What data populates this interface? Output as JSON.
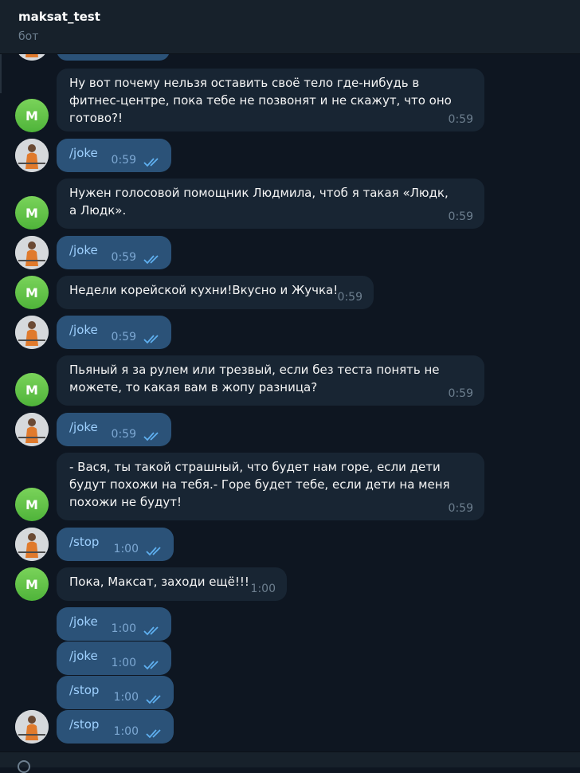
{
  "header": {
    "title": "maksat_test",
    "status": "бот"
  },
  "bot_avatar_letter": "M",
  "messages": [
    {
      "text": "Ну вот почему нельзя оставить своё тело где-нибудь в фитнес-центре, пока тебе не позвонят и не скажут, что оно готово?!",
      "time": "0:59"
    },
    {
      "text": "/joke",
      "time": "0:59"
    },
    {
      "text": "Нужен голосовой помощник Людмила, чтоб я такая «Людк, а Людк».",
      "time": "0:59"
    },
    {
      "text": "/joke",
      "time": "0:59"
    },
    {
      "text": "Недели корейской кухни!Вкусно и Жучка!",
      "time": "0:59"
    },
    {
      "text": "/joke",
      "time": "0:59"
    },
    {
      "text": "Пьяный я за рулем или трезвый, если без теста понять не можете, то какая вам в жопу разница?",
      "time": "0:59"
    },
    {
      "text": "/joke",
      "time": "0:59"
    },
    {
      "text": "- Вася, ты такой страшный, что будет нам горе, если дети будут похожи на тебя.- Горе будет тебе, если дети на меня похожи не будут!",
      "time": "0:59"
    },
    {
      "text": "/stop",
      "time": "1:00"
    },
    {
      "text": "Пока, Максат, заходи ещё!!!",
      "time": "1:00"
    },
    {
      "text": "/joke",
      "time": "1:00"
    },
    {
      "text": "/joke",
      "time": "1:00"
    },
    {
      "text": "/stop",
      "time": "1:00"
    },
    {
      "text": "/stop",
      "time": "1:00"
    }
  ],
  "colors": {
    "background": "#0e1621",
    "header": "#17212b",
    "incoming_bubble": "#182533",
    "outgoing_bubble": "#2b5278",
    "bot_avatar": "#5cbf44",
    "read_ticks": "#5fb0f0"
  },
  "icons": {
    "read_receipt": "double-check-icon",
    "user_avatar": "user-photo-avatar"
  }
}
